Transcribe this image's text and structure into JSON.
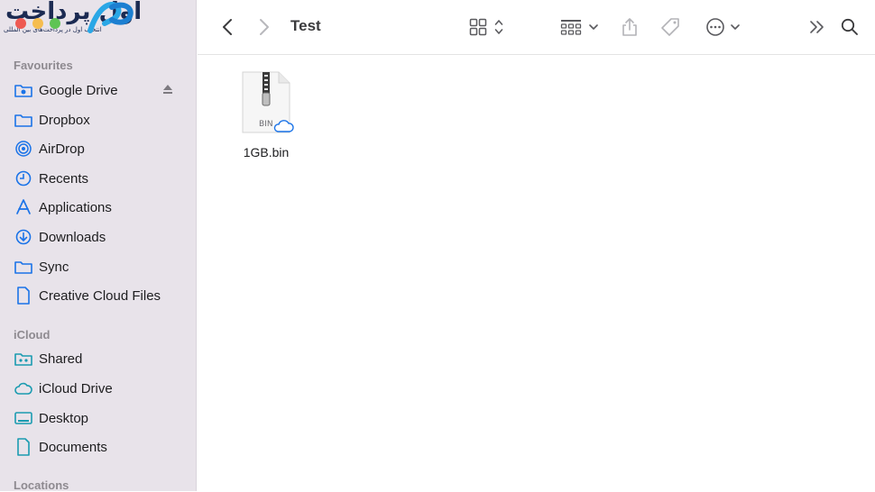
{
  "window": {
    "title": "Test"
  },
  "logo": {
    "name": "اول پرداخت",
    "tagline": "انتخاب اول در پرداخت‌های بین المللی"
  },
  "sidebar": {
    "favourites_title": "Favourites",
    "favourites": [
      {
        "label": "Google Drive",
        "icon": "google-drive-folder-icon"
      },
      {
        "label": "Dropbox",
        "icon": "folder-icon"
      },
      {
        "label": "AirDrop",
        "icon": "airdrop-icon"
      },
      {
        "label": "Recents",
        "icon": "clock-icon"
      },
      {
        "label": "Applications",
        "icon": "applications-icon"
      },
      {
        "label": "Downloads",
        "icon": "download-icon"
      },
      {
        "label": "Sync",
        "icon": "folder-icon"
      },
      {
        "label": "Creative Cloud Files",
        "icon": "document-icon"
      }
    ],
    "icloud_title": "iCloud",
    "icloud": [
      {
        "label": "Shared",
        "icon": "shared-folder-icon"
      },
      {
        "label": "iCloud Drive",
        "icon": "cloud-icon"
      },
      {
        "label": "Desktop",
        "icon": "desktop-icon"
      },
      {
        "label": "Documents",
        "icon": "document-icon"
      }
    ],
    "locations_title": "Locations"
  },
  "files": [
    {
      "name": "1GB.bin",
      "type_label": "BIN",
      "icon": "zip-archive-icon"
    }
  ],
  "colors": {
    "accent": "#1a73e8",
    "sidebar_bg": "#e8e3ea",
    "icon_gray": "#6e6e73"
  }
}
